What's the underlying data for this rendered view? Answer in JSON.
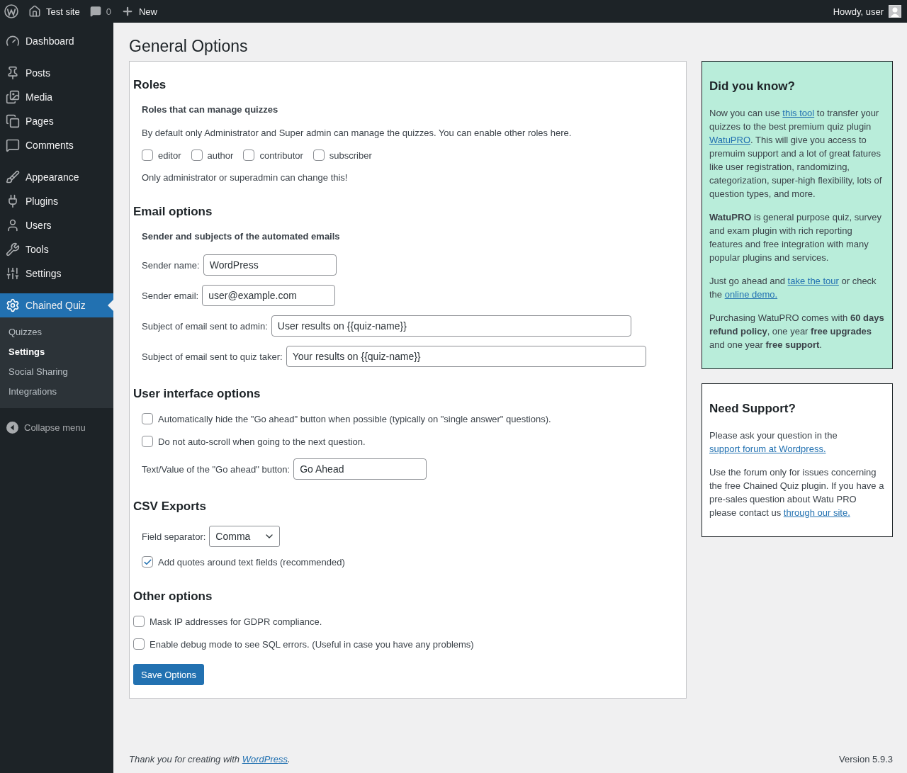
{
  "admin_bar": {
    "site_name": "Test site",
    "comments_count": "0",
    "new_label": "New",
    "greeting": "Howdy, user"
  },
  "menu_groups": [
    {
      "items": [
        {
          "label": "Dashboard",
          "selected": false
        }
      ]
    },
    {
      "items": [
        {
          "label": "Posts",
          "selected": false
        },
        {
          "label": "Media",
          "selected": false
        },
        {
          "label": "Pages",
          "selected": false
        },
        {
          "label": "Comments",
          "selected": false
        }
      ]
    },
    {
      "items": [
        {
          "label": "Appearance",
          "selected": false
        },
        {
          "label": "Plugins",
          "selected": false
        },
        {
          "label": "Users",
          "selected": false
        },
        {
          "label": "Tools",
          "selected": false
        },
        {
          "label": "Settings",
          "selected": false
        }
      ]
    },
    {
      "items": [
        {
          "label": "Chained Quiz",
          "selected": true,
          "submenu": [
            {
              "label": "Quizzes",
              "selected": false
            },
            {
              "label": "Settings",
              "selected": true
            },
            {
              "label": "Social Sharing",
              "selected": false
            },
            {
              "label": "Integrations",
              "selected": false
            }
          ]
        }
      ]
    }
  ],
  "collapse_label": "Collapse menu",
  "page_title": "General Options",
  "sections": [
    {
      "title": "Roles",
      "kind": "table",
      "subheading": "Roles that can manage quizzes",
      "rows": [
        {
          "kind": "text",
          "text": "By default only Administrator and Super admin can manage the quizzes. You can enable other roles here."
        },
        {
          "kind": "checkboxes",
          "options": [
            {
              "label": "editor",
              "checked": false
            },
            {
              "label": "author",
              "checked": false
            },
            {
              "label": "contributor",
              "checked": false
            },
            {
              "label": "subscriber",
              "checked": false
            }
          ]
        },
        {
          "kind": "text",
          "text": "Only administrator or superadmin can change this!"
        }
      ]
    },
    {
      "title": "Email options",
      "kind": "table",
      "subheading": "Sender and subjects of the automated emails",
      "rows": [
        {
          "kind": "field",
          "label": "Sender name:",
          "value": "WordPress"
        },
        {
          "kind": "field",
          "label": "Sender email:",
          "value": "user@example.com"
        },
        {
          "kind": "wide_field",
          "label": "Subject of email sent to admin:",
          "value": "User results on {{quiz-name}}"
        },
        {
          "kind": "wide_field",
          "label": "Subject of email sent to quiz taker:",
          "value": "Your results on {{quiz-name}}"
        }
      ]
    },
    {
      "title": "User interface options",
      "kind": "table",
      "rows": [
        {
          "kind": "checkbox",
          "label": "Automatically hide the \"Go ahead\" button when possible (typically on \"single answer\" questions).",
          "checked": false
        },
        {
          "kind": "checkbox",
          "label": "Do not auto-scroll when going to the next question.",
          "checked": false
        },
        {
          "kind": "field",
          "label": "Text/Value of the \"Go ahead\" button:",
          "value": "Go Ahead"
        }
      ]
    },
    {
      "title": "CSV Exports",
      "kind": "table",
      "rows": [
        {
          "kind": "select",
          "label": "Field separator:",
          "value": "Comma"
        },
        {
          "kind": "checkbox",
          "label": "Add quotes around text fields (recommended)",
          "checked": true
        }
      ]
    },
    {
      "title": "Other options",
      "kind": "plain",
      "rows": [
        {
          "kind": "checkbox",
          "label": "Mask IP addresses for GDPR compliance.",
          "checked": false
        },
        {
          "kind": "checkbox",
          "label": "Enable debug mode to see SQL errors. (Useful in case you have any problems)",
          "checked": false
        }
      ]
    }
  ],
  "save_button": "Save Options",
  "side_boxes": [
    {
      "title": "Did you know?",
      "highlighted": true,
      "paragraphs": [
        [
          {
            "kind": "text",
            "text": "Now you can use "
          },
          {
            "kind": "link",
            "text": "this tool"
          },
          {
            "kind": "text",
            "text": " to transfer your quizzes to the best premium quiz plugin "
          },
          {
            "kind": "link",
            "text": "WatuPRO"
          },
          {
            "kind": "text",
            "text": ". This will give you access to premuim support and a lot of great fatures like user registration, randomizing, categorization, super-high flexibility, lots of question types, and more."
          }
        ],
        [
          {
            "kind": "bold",
            "text": "WatuPRO"
          },
          {
            "kind": "text",
            "text": " is general purpose quiz, survey and exam plugin with rich reporting features and free integration with many popular plugins and services."
          }
        ],
        [
          {
            "kind": "text",
            "text": "Just go ahead and "
          },
          {
            "kind": "link",
            "text": "take the tour"
          },
          {
            "kind": "text",
            "text": " or check the "
          },
          {
            "kind": "link",
            "text": "online demo."
          }
        ],
        [
          {
            "kind": "text",
            "text": "Purchasing WatuPRO comes with "
          },
          {
            "kind": "bold",
            "text": "60 days refund policy"
          },
          {
            "kind": "text",
            "text": ", one year "
          },
          {
            "kind": "bold",
            "text": "free upgrades"
          },
          {
            "kind": "text",
            "text": " and one year "
          },
          {
            "kind": "bold",
            "text": "free support"
          },
          {
            "kind": "text",
            "text": "."
          }
        ]
      ]
    },
    {
      "title": "Need Support?",
      "highlighted": false,
      "paragraphs": [
        [
          {
            "kind": "text",
            "text": "Please ask your question in the "
          },
          {
            "kind": "link",
            "text": "support forum at Wordpress."
          }
        ],
        [
          {
            "kind": "text",
            "text": "Use the forum only for issues concerning the free Chained Quiz plugin. If you have a pre-sales question about Watu PRO please contact us "
          },
          {
            "kind": "link",
            "text": "through our site."
          }
        ]
      ]
    }
  ],
  "footer": {
    "thanks": [
      {
        "kind": "text",
        "text": "Thank you for creating with "
      },
      {
        "kind": "link",
        "text": "WordPress"
      },
      {
        "kind": "text",
        "text": "."
      }
    ],
    "version": "Version 5.9.3"
  }
}
